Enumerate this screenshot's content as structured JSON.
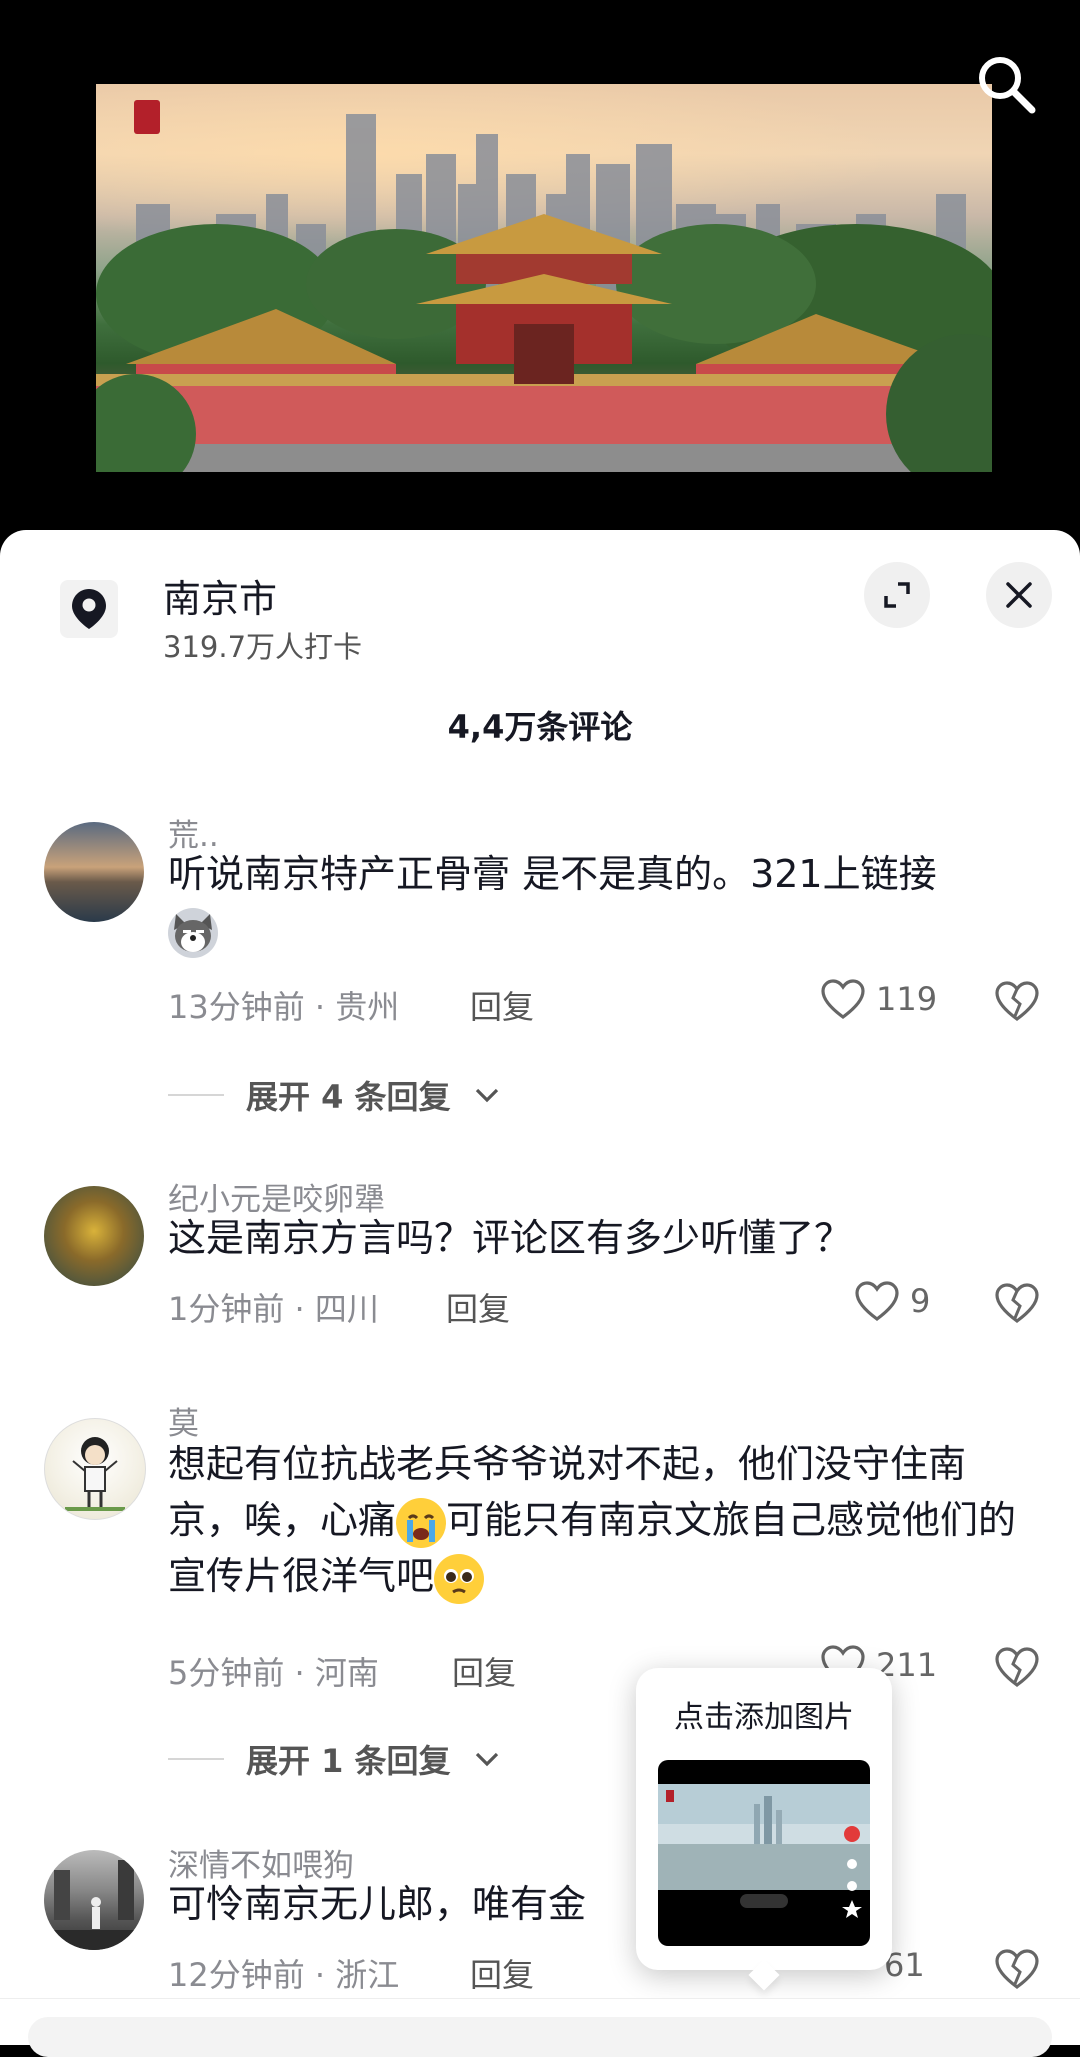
{
  "location": {
    "name": "南京市",
    "checkins": "319.7万人打卡"
  },
  "comments_header": {
    "count_label": "4,4万条评论"
  },
  "comments": [
    {
      "user": "荒..",
      "text": "听说南京特产正骨膏 是不是真的。321上链接",
      "time_location": "13分钟前 · 贵州",
      "reply_label": "回复",
      "likes": "119",
      "expand_label": "展开 4 条回复"
    },
    {
      "user": "纪小元是咬卵犟",
      "text": "这是南京方言吗？评论区有多少听懂了？",
      "time_location": "1分钟前 · 四川",
      "reply_label": "回复",
      "likes": "9"
    },
    {
      "user": "莫",
      "text_a": "想起有位抗战老兵爷爷说对不起，他们没守住南京，唉，心痛",
      "text_b": "可能只有南京文旅自己感觉他们的宣传片很洋气吧",
      "time_location": "5分钟前 · 河南",
      "reply_label": "回复",
      "likes": "211",
      "expand_label": "展开 1 条回复"
    },
    {
      "user": "深情不如喂狗",
      "text": "可怜南京无儿郎，唯有金",
      "time_location": "12分钟前 · 浙江",
      "reply_label": "回复",
      "likes": "61"
    }
  ],
  "popup": {
    "title": "点击添加图片"
  },
  "icons": {
    "search": "search-icon",
    "location": "location-pin-icon",
    "expand": "expand-icon",
    "close": "close-icon",
    "like": "heart-icon",
    "dislike": "broken-heart-icon",
    "chevron": "chevron-down-icon"
  }
}
